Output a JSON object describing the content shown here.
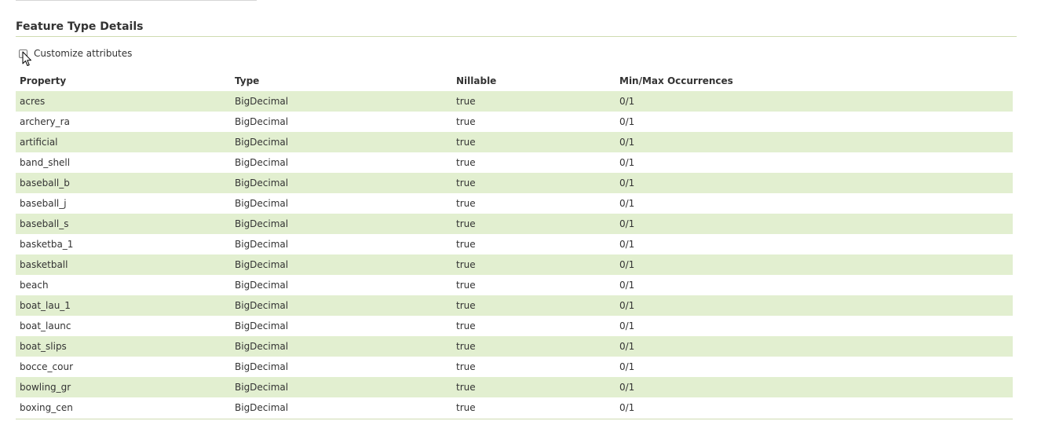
{
  "section": {
    "title": "Feature Type Details"
  },
  "customize": {
    "label": "Customize attributes",
    "checked": false
  },
  "table": {
    "headers": {
      "property": "Property",
      "type": "Type",
      "nillable": "Nillable",
      "occurrences": "Min/Max Occurrences"
    },
    "rows": [
      {
        "property": "acres",
        "type": "BigDecimal",
        "nillable": "true",
        "occurrences": "0/1"
      },
      {
        "property": "archery_ra",
        "type": "BigDecimal",
        "nillable": "true",
        "occurrences": "0/1"
      },
      {
        "property": "artificial",
        "type": "BigDecimal",
        "nillable": "true",
        "occurrences": "0/1"
      },
      {
        "property": "band_shell",
        "type": "BigDecimal",
        "nillable": "true",
        "occurrences": "0/1"
      },
      {
        "property": "baseball_b",
        "type": "BigDecimal",
        "nillable": "true",
        "occurrences": "0/1"
      },
      {
        "property": "baseball_j",
        "type": "BigDecimal",
        "nillable": "true",
        "occurrences": "0/1"
      },
      {
        "property": "baseball_s",
        "type": "BigDecimal",
        "nillable": "true",
        "occurrences": "0/1"
      },
      {
        "property": "basketba_1",
        "type": "BigDecimal",
        "nillable": "true",
        "occurrences": "0/1"
      },
      {
        "property": "basketball",
        "type": "BigDecimal",
        "nillable": "true",
        "occurrences": "0/1"
      },
      {
        "property": "beach",
        "type": "BigDecimal",
        "nillable": "true",
        "occurrences": "0/1"
      },
      {
        "property": "boat_lau_1",
        "type": "BigDecimal",
        "nillable": "true",
        "occurrences": "0/1"
      },
      {
        "property": "boat_launc",
        "type": "BigDecimal",
        "nillable": "true",
        "occurrences": "0/1"
      },
      {
        "property": "boat_slips",
        "type": "BigDecimal",
        "nillable": "true",
        "occurrences": "0/1"
      },
      {
        "property": "bocce_cour",
        "type": "BigDecimal",
        "nillable": "true",
        "occurrences": "0/1"
      },
      {
        "property": "bowling_gr",
        "type": "BigDecimal",
        "nillable": "true",
        "occurrences": "0/1"
      },
      {
        "property": "boxing_cen",
        "type": "BigDecimal",
        "nillable": "true",
        "occurrences": "0/1"
      }
    ]
  },
  "icons": {
    "cursor": "mouse-pointer-icon"
  },
  "colors": {
    "row_stripe": "#e2efd0",
    "rule": "#cfdcb1",
    "text": "#333333"
  }
}
